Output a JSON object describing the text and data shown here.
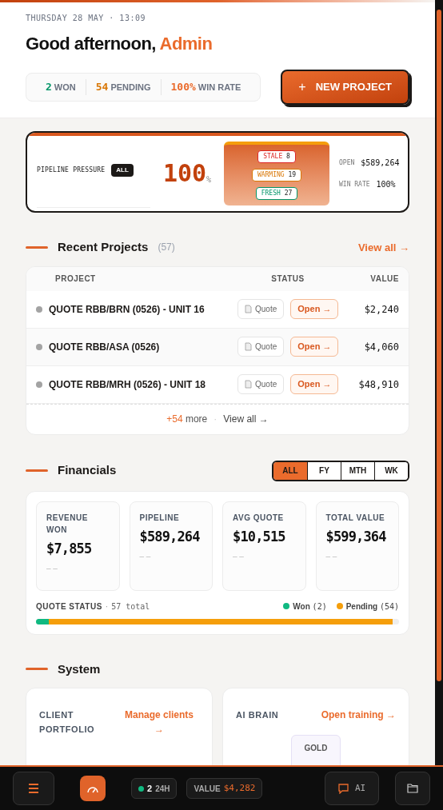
{
  "header": {
    "datetime": "THURSDAY 28 MAY · 13:09",
    "greeting": "Good afternoon,",
    "name": "Admin",
    "stats": [
      {
        "value": "2",
        "label": "WON",
        "color": "#059669"
      },
      {
        "value": "54",
        "label": "PENDING",
        "color": "#d97706"
      },
      {
        "value": "100%",
        "label": "WIN RATE",
        "color": "#ea6b2c"
      }
    ],
    "new_project_button": {
      "icon": "+",
      "label": "NEW PROJECT"
    }
  },
  "pipeline": {
    "label": "PIPELINE PRESSURE",
    "filter": "ALL",
    "value": "100",
    "unit": "%",
    "tiers": [
      {
        "label": "STALE",
        "count": "8",
        "color": "#dc2626"
      },
      {
        "label": "WARMING",
        "count": "19",
        "color": "#d97706"
      },
      {
        "label": "FRESH",
        "count": "27",
        "color": "#059669"
      }
    ],
    "stats": [
      {
        "label": "OPEN",
        "value": "$589,264"
      },
      {
        "label": "WIN RATE",
        "value": "100%"
      }
    ]
  },
  "recent_projects": {
    "title": "Recent Projects",
    "count": "(57)",
    "view_all": "View all →",
    "columns": [
      "PROJECT",
      "STATUS",
      "VALUE"
    ],
    "rows": [
      {
        "name": "QUOTE RBB/BRN (0526) - UNIT 16",
        "status": "Quote",
        "action": "Open →",
        "value": "$2,240"
      },
      {
        "name": "QUOTE RBB/ASA (0526)",
        "status": "Quote",
        "action": "Open →",
        "value": "$4,060"
      },
      {
        "name": "QUOTE RBB/MRH (0526) - UNIT 18",
        "status": "Quote",
        "action": "Open →",
        "value": "$48,910"
      }
    ],
    "more": "+54",
    "more_label": "more",
    "separator": "·",
    "footer_link": "View all →"
  },
  "financials": {
    "title": "Financials",
    "periods": [
      {
        "label": "ALL",
        "selected": true
      },
      {
        "label": "FY",
        "selected": false
      },
      {
        "label": "MTH",
        "selected": false
      },
      {
        "label": "WK",
        "selected": false
      }
    ],
    "cards": [
      {
        "label": "REVENUE WON",
        "value": "$7,855",
        "trend": "– –"
      },
      {
        "label": "PIPELINE",
        "value": "$589,264",
        "trend": "– –"
      },
      {
        "label": "AVG QUOTE",
        "value": "$10,515",
        "trend": "– –"
      },
      {
        "label": "TOTAL VALUE",
        "value": "$599,364",
        "trend": "– –"
      }
    ],
    "quote_status": {
      "label": "QUOTE STATUS",
      "separator": "·",
      "total": "57 total",
      "segments": [
        {
          "label": "Won",
          "count": "(2)",
          "color": "#10b981",
          "level": 0.035
        },
        {
          "label": "Pending",
          "count": "(54)",
          "color": "#f59e0b"
        }
      ]
    }
  },
  "system": {
    "title": "System",
    "cards": [
      {
        "title": "CLIENT PORTFOLIO",
        "link": "Manage clients →"
      },
      {
        "title": "AI BRAIN",
        "link": "Open training →",
        "chips": [
          "GOLD"
        ]
      }
    ]
  },
  "bottom_bar": {
    "live_count": "2",
    "live_label": "24H",
    "value_label": "VALUE",
    "value": "$4,282",
    "ai_label": "AI"
  }
}
